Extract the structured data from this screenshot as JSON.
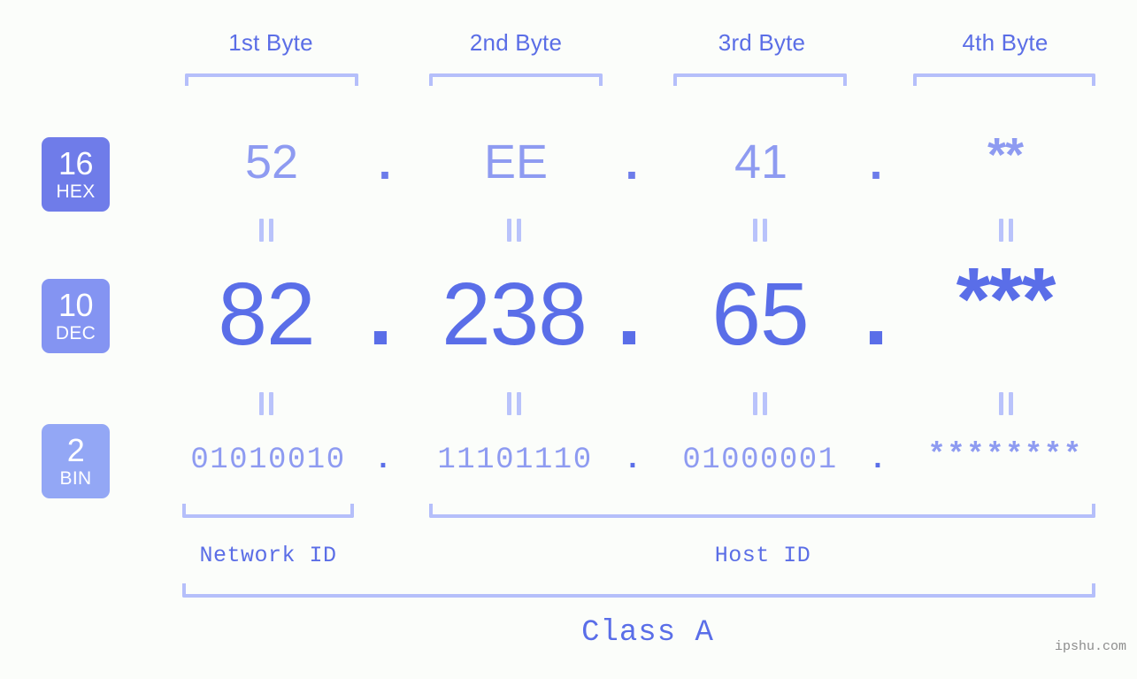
{
  "page": {
    "background": "#fbfdfa",
    "accent": "#5a6ee8",
    "accent_light": "#8e9bf1",
    "bracket_color": "#b5bffa",
    "watermark": "ipshu.com"
  },
  "byte_headers": [
    {
      "label": "1st Byte"
    },
    {
      "label": "2nd Byte"
    },
    {
      "label": "3rd Byte"
    },
    {
      "label": "4th Byte"
    }
  ],
  "bases": [
    {
      "number": "16",
      "name": "HEX",
      "color": "#6f7ce9"
    },
    {
      "number": "10",
      "name": "DEC",
      "color": "#8494f2"
    },
    {
      "number": "2",
      "name": "BIN",
      "color": "#93a7f5"
    }
  ],
  "rows": {
    "hex": {
      "values": [
        "52",
        "EE",
        "41",
        "**"
      ],
      "separator": "."
    },
    "dec": {
      "values": [
        "82",
        "238",
        "65",
        "***"
      ],
      "separator": "."
    },
    "bin": {
      "values": [
        "01010010",
        "11101110",
        "01000001",
        "********"
      ],
      "separator": "."
    }
  },
  "equals_marks": {
    "symbol": "||",
    "count_per_row": 4
  },
  "segments": [
    {
      "label": "Network ID"
    },
    {
      "label": "Host ID"
    }
  ],
  "class": {
    "label": "Class A"
  }
}
